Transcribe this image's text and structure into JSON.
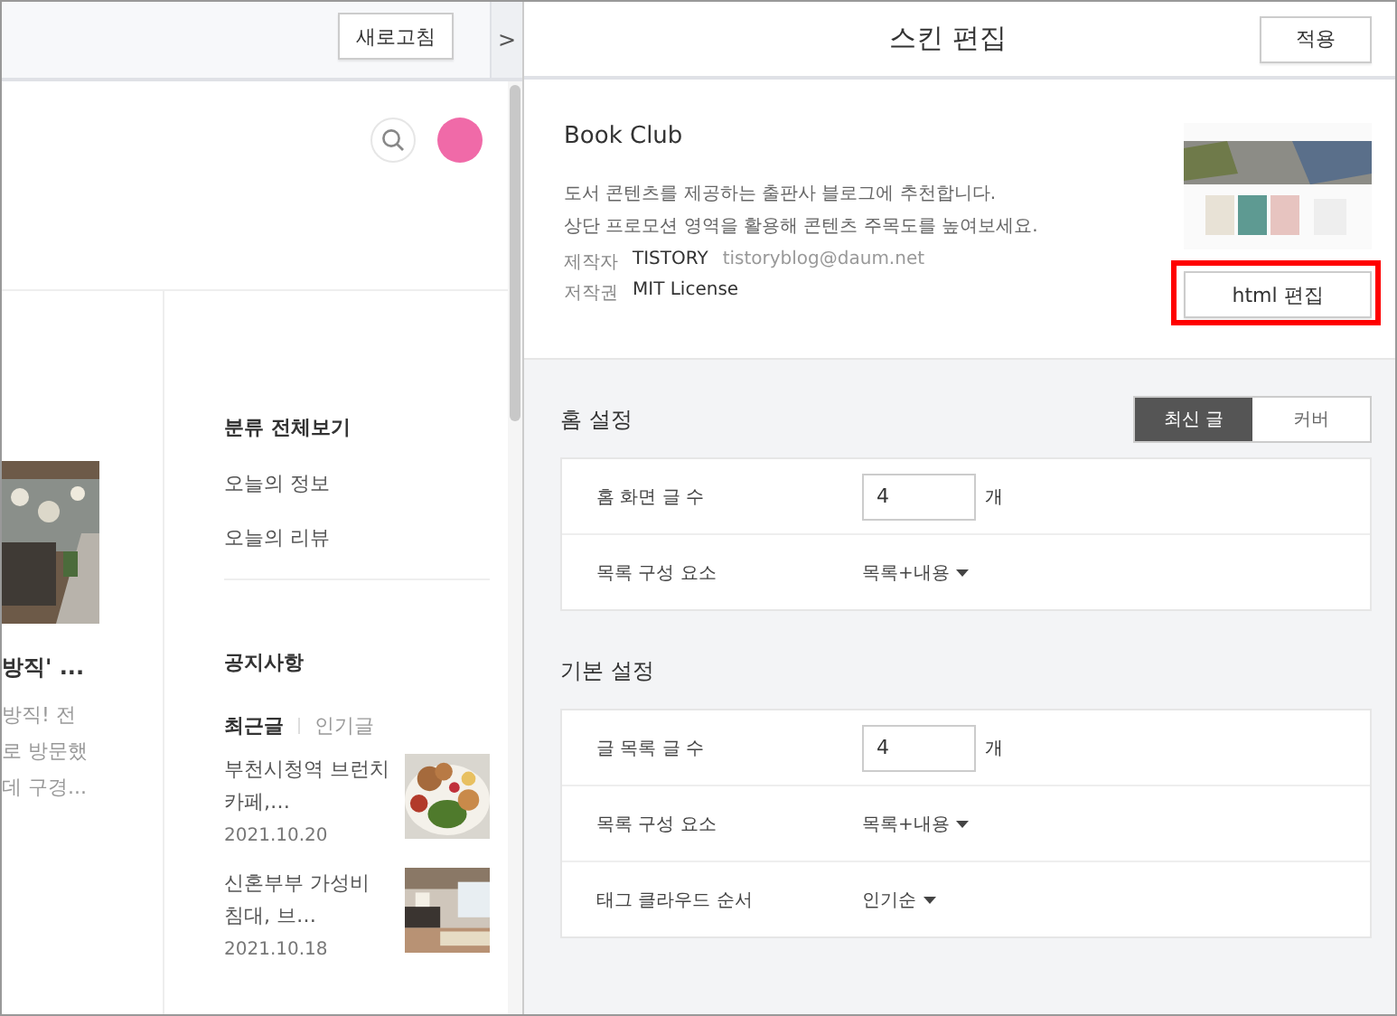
{
  "preview": {
    "toolbar": {
      "refresh_button": "새로고침",
      "collapse_toggle": ">"
    },
    "post": {
      "title": "방직' ...",
      "excerpt_lines": [
        "방직! 전",
        "로 방문했",
        "데 구경..."
      ]
    },
    "sidebar": {
      "category_heading": "분류 전체보기",
      "categories": [
        "오늘의 정보",
        "오늘의 리뷰"
      ],
      "notice_heading": "공지사항",
      "post_tabs": [
        {
          "label": "최근글",
          "selected": true
        },
        {
          "label": "인기글",
          "selected": false
        }
      ],
      "recent_posts": [
        {
          "title_lines": [
            "부천시청역 브런치",
            "카페,…"
          ],
          "date": "2021.10.20"
        },
        {
          "title_lines": [
            "신혼부부 가성비",
            "침대, 브…"
          ],
          "date": "2021.10.18"
        }
      ]
    }
  },
  "editor": {
    "title": "스킨 편집",
    "apply_button": "적용",
    "skin": {
      "name": "Book Club",
      "description_lines": [
        "도서 콘텐츠를 제공하는 출판사 블로그에 추천합니다.",
        "상단 프로모션 영역을 활용해 콘텐츠 주목도를 높여보세요."
      ],
      "meta": [
        {
          "label": "제작자",
          "value": "TISTORY",
          "extra": "tistoryblog@daum.net"
        },
        {
          "label": "저작권",
          "value": "MIT License"
        }
      ],
      "html_edit_button": "html 편집",
      "highlighted": true
    },
    "sections": [
      {
        "title": "홈 설정",
        "modes": [
          {
            "label": "최신 글",
            "selected": true
          },
          {
            "label": "커버",
            "selected": false
          }
        ],
        "rows": [
          {
            "kind": "number",
            "label": "홈 화면 글 수",
            "value": "4",
            "unit": "개"
          },
          {
            "kind": "dropdown",
            "label": "목록 구성 요소",
            "value": "목록+내용"
          }
        ]
      },
      {
        "title": "기본 설정",
        "rows": [
          {
            "kind": "number",
            "label": "글 목록 글 수",
            "value": "4",
            "unit": "개"
          },
          {
            "kind": "dropdown",
            "label": "목록 구성 요소",
            "value": "목록+내용"
          },
          {
            "kind": "dropdown",
            "label": "태그 클라우드 순서",
            "value": "인기순"
          }
        ]
      }
    ]
  }
}
